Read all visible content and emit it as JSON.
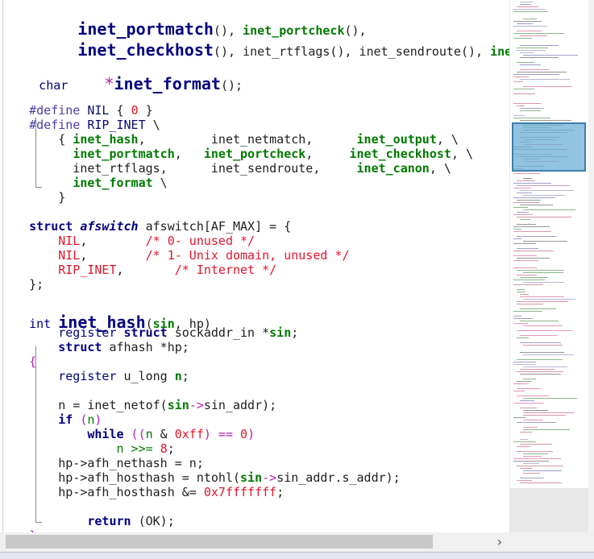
{
  "colors": {
    "keyword": "#000080",
    "green_fn": "#007a00",
    "red_value": "#e0162b",
    "preprocessor": "#4b3fa8",
    "operator": "#b020b0",
    "minimap_viewport": "#6eafd7"
  },
  "code": {
    "l1": {
      "indent": "    ",
      "a": "inet_portmatch",
      "b": "(), ",
      "c": "inet_portcheck",
      "d": "(),"
    },
    "l2": {
      "indent": "    ",
      "a": "inet_checkhost",
      "b": "(), ",
      "c": "inet_rtflags(), inet_sendroute(), ",
      "d": "inet_canc"
    },
    "l3": {
      "type": "char",
      "gap": "     ",
      "star": "*",
      "name": "inet_format",
      "rest": "();"
    },
    "l4": {
      "define": "#define",
      "name": " NIL ",
      "open": "{ ",
      "zero": "0",
      "close": " }"
    },
    "l5": {
      "define": "#define",
      "name": " RIP_INET ",
      "bs": "\\"
    },
    "l6": {
      "a": "    { ",
      "b": "inet_hash",
      "c": ",         inet_netmatch,      ",
      "d": "inet_output",
      "e": ", \\"
    },
    "l7": {
      "a": "      ",
      "b": "inet_portmatch",
      "c": ",   ",
      "d": "inet_portcheck",
      "e": ",     ",
      "f": "inet_checkhost",
      "g": ", \\"
    },
    "l8": {
      "a": "      inet_rtflags,      inet_sendroute,     ",
      "b": "inet_canon",
      "c": ", \\"
    },
    "l9": {
      "a": "      ",
      "b": "inet_format",
      "c": " \\"
    },
    "l10": {
      "a": "    }"
    },
    "l11": {
      "kw": "struct",
      "sp": " ",
      "tn": "afswitch",
      "rest": " afswitch[AF_MAX] = {"
    },
    "l12": {
      "a": "    ",
      "v": "NIL",
      "b": ",        ",
      "c": "/* 0- unused */"
    },
    "l13": {
      "a": "    ",
      "v": "NIL",
      "b": ",        ",
      "c": "/* 1- Unix domain, unused */"
    },
    "l14": {
      "a": "    ",
      "v": "RIP_INET",
      "b": ",       ",
      "c": "/* Internet */"
    },
    "l15": {
      "a": "};"
    },
    "l16": {
      "type": "int",
      "sp": " ",
      "name": "inet_hash",
      "p1": "(",
      "sin": "sin",
      "p2": ", hp)"
    },
    "l17": {
      "a": "    ",
      "kw1": "register",
      "sp1": " ",
      "kw2": "struct",
      "b": " sockaddr_in *",
      "sin": "sin",
      "c": ";"
    },
    "l18": {
      "a": "    ",
      "kw": "struct",
      "b": " afhash *hp;"
    },
    "l19": {
      "a": "{"
    },
    "l20": {
      "a": "    ",
      "kw": "register",
      "b": " u_long ",
      "n": "n",
      "c": ";"
    },
    "l21": {
      "a": "    n = inet_netof(",
      "sin": "sin",
      "arrow": "->",
      "b": "sin_addr);"
    },
    "l22": {
      "a": "    ",
      "kw": "if",
      "b": " (",
      "n": "n",
      "c": ")"
    },
    "l23": {
      "a": "        ",
      "kw": "while",
      "b": " ((",
      "n": "n",
      "c": " & ",
      "hex": "0xff",
      "d": ") == ",
      "z": "0",
      "e": ")"
    },
    "l24": {
      "a": "            n >>= ",
      "v": "8",
      "b": ";"
    },
    "l25": {
      "a": "    hp->afh_nethash = n;"
    },
    "l26": {
      "a": "    hp->afh_hosthash = ntohl(",
      "sin": "sin",
      "arrow": "->",
      "b": "sin_addr.s_addr);"
    },
    "l27": {
      "a": "    hp->afh_hosthash &= ",
      "hex": "0x7fffffff",
      "b": ";"
    },
    "l28": {
      "a": "        ",
      "kw": "return",
      "b": " (OK);"
    },
    "l29": {
      "a": "}"
    }
  },
  "scrollbar": {
    "right_arrow": "›"
  }
}
